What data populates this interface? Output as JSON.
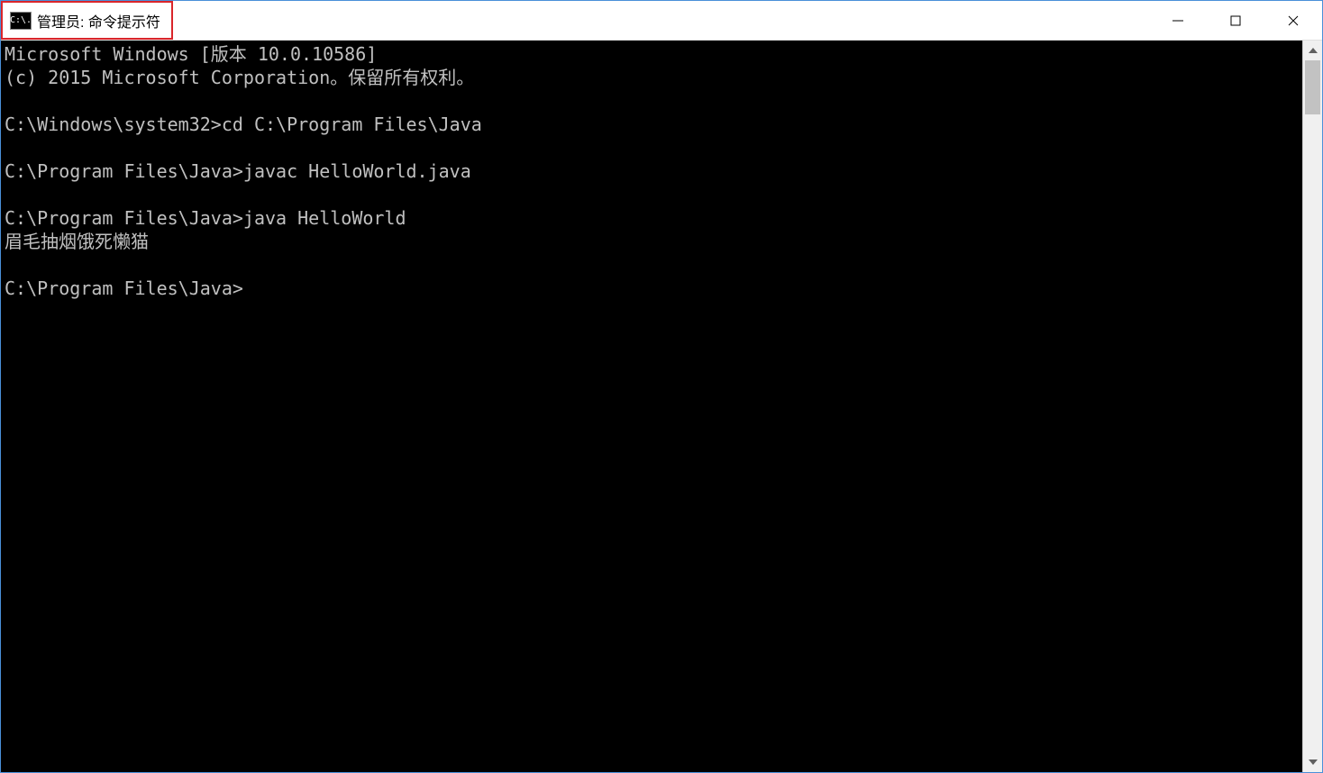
{
  "window": {
    "title": "管理员: 命令提示符",
    "icon_label": "C:\\."
  },
  "terminal": {
    "lines": [
      "Microsoft Windows [版本 10.0.10586]",
      "(c) 2015 Microsoft Corporation。保留所有权利。",
      "",
      "C:\\Windows\\system32>cd C:\\Program Files\\Java",
      "",
      "C:\\Program Files\\Java>javac HelloWorld.java",
      "",
      "C:\\Program Files\\Java>java HelloWorld",
      "眉毛抽烟饿死懒猫",
      "",
      "C:\\Program Files\\Java>"
    ]
  },
  "controls": {
    "minimize_label": "Minimize",
    "maximize_label": "Maximize",
    "close_label": "Close"
  }
}
